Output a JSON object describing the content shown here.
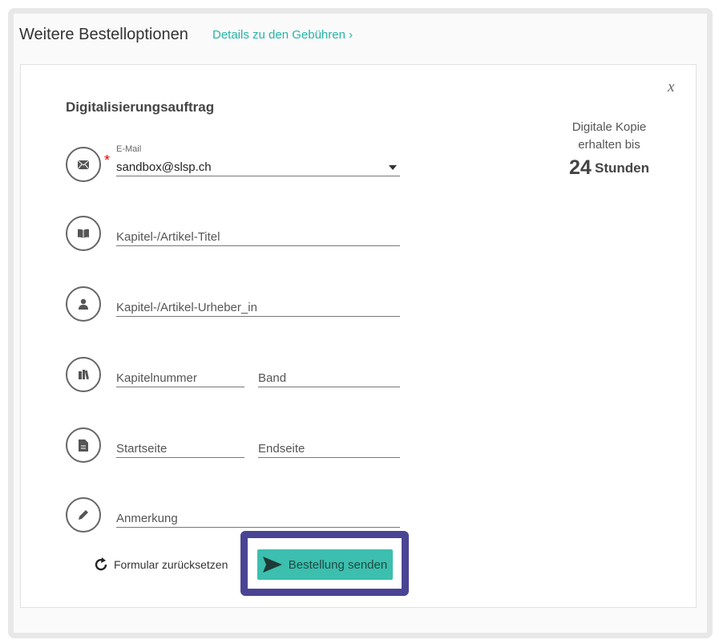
{
  "header": {
    "title": "Weitere Bestelloptionen",
    "fees_link": "Details zu den Gebühren ›"
  },
  "form": {
    "close_label": "x",
    "title": "Digitalisierungsauftrag",
    "email": {
      "label": "E-Mail",
      "required_mark": "*",
      "value": "sandbox@slsp.ch"
    },
    "chapter_title": {
      "placeholder": "Kapitel-/Artikel-Titel"
    },
    "chapter_author": {
      "placeholder": "Kapitel-/Artikel-Urheber_in"
    },
    "chapter_number": {
      "placeholder": "Kapitelnummer"
    },
    "volume": {
      "placeholder": "Band"
    },
    "start_page": {
      "placeholder": "Startseite"
    },
    "end_page": {
      "placeholder": "Endseite"
    },
    "note": {
      "placeholder": "Anmerkung"
    },
    "reset_label": "Formular zurücksetzen",
    "submit_label": "Bestellung senden"
  },
  "delivery": {
    "line1": "Digitale Kopie",
    "line2": "erhalten bis",
    "hours": "24",
    "unit": "Stunden"
  },
  "colors": {
    "accent": "#3cbfae",
    "link": "#26b3a6",
    "highlight": "#4a4494"
  }
}
